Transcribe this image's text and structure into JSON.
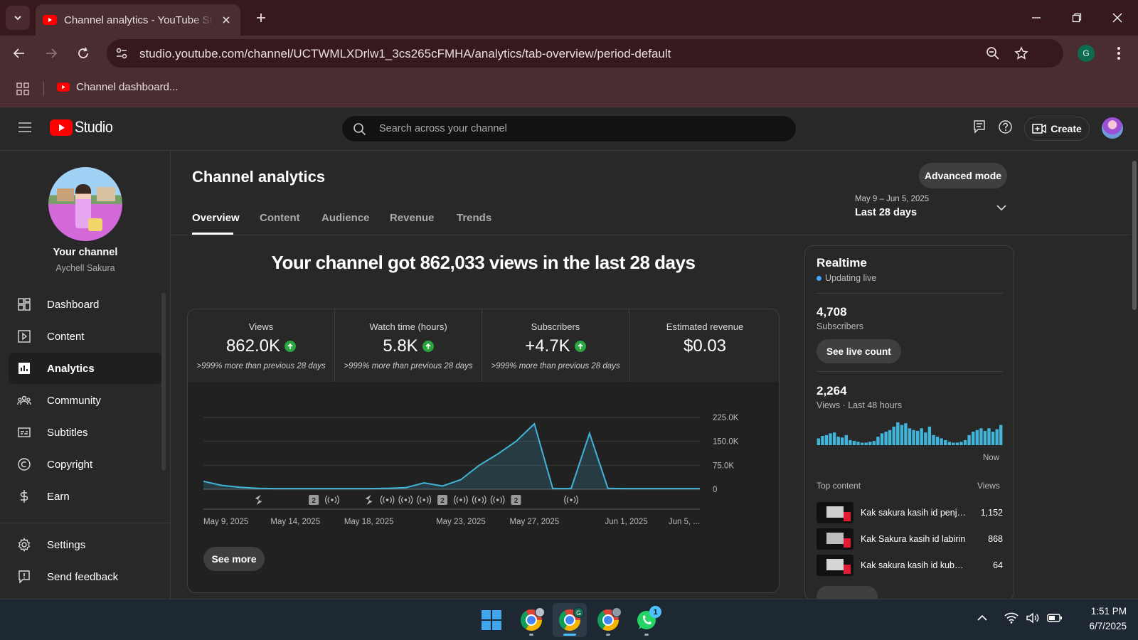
{
  "browser": {
    "tab_title": "Channel analytics - YouTube Studio",
    "url": "studio.youtube.com/channel/UCTWMLXDrlw1_3cs265cFMHA/analytics/tab-overview/period-default",
    "profile_initial": "G",
    "bookmark_label": "Channel dashboard..."
  },
  "studio": {
    "logo_text": "Studio",
    "search_placeholder": "Search across your channel",
    "create_label": "Create"
  },
  "sidebar": {
    "channel_heading": "Your channel",
    "channel_name": "Aychell Sakura",
    "items": [
      {
        "label": "Dashboard",
        "icon": "dashboard-icon"
      },
      {
        "label": "Content",
        "icon": "content-icon"
      },
      {
        "label": "Analytics",
        "icon": "analytics-icon",
        "active": true
      },
      {
        "label": "Community",
        "icon": "community-icon"
      },
      {
        "label": "Subtitles",
        "icon": "subtitles-icon"
      },
      {
        "label": "Copyright",
        "icon": "copyright-icon"
      },
      {
        "label": "Earn",
        "icon": "earn-icon"
      }
    ],
    "bottom_items": [
      {
        "label": "Settings",
        "icon": "gear-icon"
      },
      {
        "label": "Send feedback",
        "icon": "feedback-icon"
      }
    ]
  },
  "analytics": {
    "title": "Channel analytics",
    "advanced_label": "Advanced mode",
    "tabs": [
      "Overview",
      "Content",
      "Audience",
      "Revenue",
      "Trends"
    ],
    "period_range": "May 9 – Jun 5, 2025",
    "period_label": "Last 28 days",
    "headline": "Your channel got 862,033 views in the last 28 days",
    "metrics": [
      {
        "label": "Views",
        "value": "862.0K",
        "delta": ">999% more than previous 28 days",
        "up": true
      },
      {
        "label": "Watch time (hours)",
        "value": "5.8K",
        "delta": ">999% more than previous 28 days",
        "up": true
      },
      {
        "label": "Subscribers",
        "value": "+4.7K",
        "delta": ">999% more than previous 28 days",
        "up": true
      },
      {
        "label": "Estimated revenue",
        "value": "$0.03",
        "delta": "",
        "up": false
      }
    ],
    "see_more_label": "See more"
  },
  "chart_data": {
    "type": "area",
    "x": [
      "May 9",
      "May 10",
      "May 11",
      "May 12",
      "May 13",
      "May 14",
      "May 15",
      "May 16",
      "May 17",
      "May 18",
      "May 19",
      "May 20",
      "May 21",
      "May 22",
      "May 23",
      "May 24",
      "May 25",
      "May 26",
      "May 27",
      "May 28",
      "May 29",
      "May 30",
      "May 31",
      "Jun 1",
      "Jun 2",
      "Jun 3",
      "Jun 4",
      "Jun 5"
    ],
    "series": [
      {
        "values": [
          25000,
          12000,
          6000,
          3000,
          2000,
          2000,
          2000,
          2000,
          2000,
          2000,
          3000,
          5000,
          20000,
          10000,
          30000,
          75000,
          110000,
          150000,
          205000,
          2000,
          2000,
          175000,
          3000,
          2000,
          2000,
          2000,
          2000,
          2000
        ]
      }
    ],
    "y_ticks": [
      "225.0K",
      "150.0K",
      "75.0K",
      "0"
    ],
    "ylim": [
      0,
      225000
    ],
    "x_tick_labels": [
      "May 9, 2025",
      "May 14, 2025",
      "May 18, 2025",
      "May 23, 2025",
      "May 27, 2025",
      "Jun 1, 2025",
      "Jun 5, ..."
    ],
    "color": "#41b4d9",
    "grid": true
  },
  "realtime": {
    "title": "Realtime",
    "status": "Updating live",
    "subscribers_value": "4,708",
    "subscribers_label": "Subscribers",
    "live_count_label": "See live count",
    "views_value": "2,264",
    "views_label": "Views · Last 48 hours",
    "now_label": "Now",
    "bars": [
      8,
      11,
      12,
      14,
      15,
      10,
      9,
      12,
      6,
      5,
      4,
      3,
      3,
      4,
      5,
      10,
      14,
      16,
      18,
      22,
      27,
      24,
      26,
      20,
      18,
      17,
      20,
      15,
      22,
      12,
      10,
      8,
      6,
      4,
      3,
      3,
      4,
      6,
      12,
      16,
      18,
      20,
      17,
      20,
      16,
      19,
      24
    ],
    "top_content_label": "Top content",
    "views_col_label": "Views",
    "top_content": [
      {
        "title": "Kak sakura kasih id penjara",
        "views": "1,152"
      },
      {
        "title": "Kak Sakura kasih id labirin",
        "views": "868"
      },
      {
        "title": "Kak sakura kasih id kuburan",
        "views": "64"
      }
    ]
  },
  "taskbar": {
    "time": "1:51 PM",
    "date": "6/7/2025",
    "whatsapp_badge": "1"
  },
  "colors": {
    "accent_red": "#ff0000",
    "chart_line": "#41b4d9",
    "up_green": "#2ba640",
    "live_blue": "#3ea6ff"
  }
}
